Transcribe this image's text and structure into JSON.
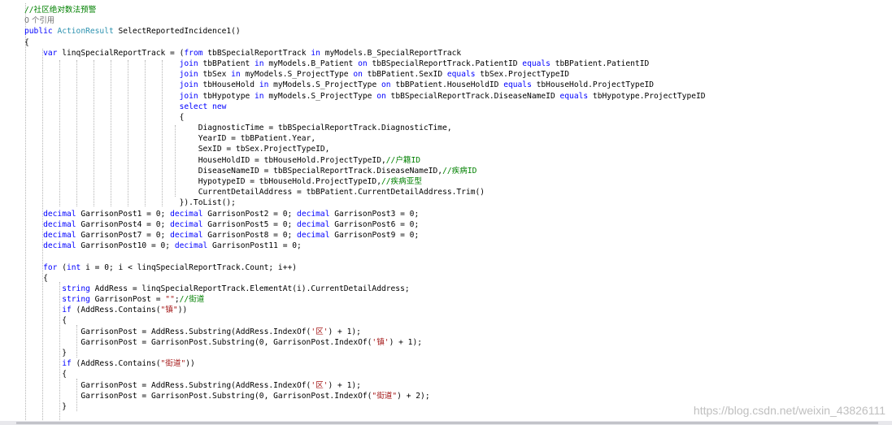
{
  "editor": {
    "code_lines": [
      {
        "indent": 0,
        "tokens": [
          {
            "t": "//社区绝对数法预警",
            "c": "com"
          }
        ]
      },
      {
        "indent": 0,
        "tokens": [
          {
            "t": "0 个引用",
            "c": "ref"
          }
        ]
      },
      {
        "indent": 0,
        "tokens": [
          {
            "t": "public ",
            "c": "kw"
          },
          {
            "t": "ActionResult",
            "c": "cls"
          },
          {
            "t": " SelectReportedIncidence1()",
            "c": "txt"
          }
        ]
      },
      {
        "indent": 0,
        "tokens": [
          {
            "t": "{",
            "c": "txt"
          }
        ]
      },
      {
        "indent": 4,
        "tokens": [
          {
            "t": "var",
            "c": "kw"
          },
          {
            "t": " linqSpecialReportTrack = (",
            "c": "txt"
          },
          {
            "t": "from",
            "c": "kw"
          },
          {
            "t": " tbBSpecialReportTrack ",
            "c": "txt"
          },
          {
            "t": "in",
            "c": "kw"
          },
          {
            "t": " myModels.B_SpecialReportTrack",
            "c": "txt"
          }
        ]
      },
      {
        "indent": 33,
        "tokens": [
          {
            "t": "join",
            "c": "kw"
          },
          {
            "t": " tbBPatient ",
            "c": "txt"
          },
          {
            "t": "in",
            "c": "kw"
          },
          {
            "t": " myModels.B_Patient ",
            "c": "txt"
          },
          {
            "t": "on",
            "c": "kw"
          },
          {
            "t": " tbBSpecialReportTrack.PatientID ",
            "c": "txt"
          },
          {
            "t": "equals",
            "c": "kw"
          },
          {
            "t": " tbBPatient.PatientID",
            "c": "txt"
          }
        ]
      },
      {
        "indent": 33,
        "tokens": [
          {
            "t": "join",
            "c": "kw"
          },
          {
            "t": " tbSex ",
            "c": "txt"
          },
          {
            "t": "in",
            "c": "kw"
          },
          {
            "t": " myModels.S_ProjectType ",
            "c": "txt"
          },
          {
            "t": "on",
            "c": "kw"
          },
          {
            "t": " tbBPatient.SexID ",
            "c": "txt"
          },
          {
            "t": "equals",
            "c": "kw"
          },
          {
            "t": " tbSex.ProjectTypeID",
            "c": "txt"
          }
        ]
      },
      {
        "indent": 33,
        "tokens": [
          {
            "t": "join",
            "c": "kw"
          },
          {
            "t": " tbHouseHold ",
            "c": "txt"
          },
          {
            "t": "in",
            "c": "kw"
          },
          {
            "t": " myModels.S_ProjectType ",
            "c": "txt"
          },
          {
            "t": "on",
            "c": "kw"
          },
          {
            "t": " tbBPatient.HouseHoldID ",
            "c": "txt"
          },
          {
            "t": "equals",
            "c": "kw"
          },
          {
            "t": " tbHouseHold.ProjectTypeID",
            "c": "txt"
          }
        ]
      },
      {
        "indent": 33,
        "tokens": [
          {
            "t": "join",
            "c": "kw"
          },
          {
            "t": " tbHypotype ",
            "c": "txt"
          },
          {
            "t": "in",
            "c": "kw"
          },
          {
            "t": " myModels.S_ProjectType ",
            "c": "txt"
          },
          {
            "t": "on",
            "c": "kw"
          },
          {
            "t": " tbBSpecialReportTrack.DiseaseNameID ",
            "c": "txt"
          },
          {
            "t": "equals",
            "c": "kw"
          },
          {
            "t": " tbHypotype.ProjectTypeID",
            "c": "txt"
          }
        ]
      },
      {
        "indent": 33,
        "tokens": [
          {
            "t": "select",
            "c": "kw"
          },
          {
            "t": " ",
            "c": "txt"
          },
          {
            "t": "new",
            "c": "kw"
          }
        ]
      },
      {
        "indent": 33,
        "tokens": [
          {
            "t": "{",
            "c": "txt"
          }
        ]
      },
      {
        "indent": 37,
        "tokens": [
          {
            "t": "DiagnosticTime = tbBSpecialReportTrack.DiagnosticTime,",
            "c": "txt"
          }
        ]
      },
      {
        "indent": 37,
        "tokens": [
          {
            "t": "YearID = tbBPatient.Year,",
            "c": "txt"
          }
        ]
      },
      {
        "indent": 37,
        "tokens": [
          {
            "t": "SexID = tbSex.ProjectTypeID,",
            "c": "txt"
          }
        ]
      },
      {
        "indent": 37,
        "tokens": [
          {
            "t": "HouseHoldID = tbHouseHold.ProjectTypeID,",
            "c": "txt"
          },
          {
            "t": "//户籍ID",
            "c": "com"
          }
        ]
      },
      {
        "indent": 37,
        "tokens": [
          {
            "t": "DiseaseNameID = tbBSpecialReportTrack.DiseaseNameID,",
            "c": "txt"
          },
          {
            "t": "//疾病ID",
            "c": "com"
          }
        ]
      },
      {
        "indent": 37,
        "tokens": [
          {
            "t": "HypotypeID = tbHouseHold.ProjectTypeID,",
            "c": "txt"
          },
          {
            "t": "//疾病亚型",
            "c": "com"
          }
        ]
      },
      {
        "indent": 37,
        "tokens": [
          {
            "t": "CurrentDetailAddress = tbBPatient.CurrentDetailAddress.Trim()",
            "c": "txt"
          }
        ]
      },
      {
        "indent": 33,
        "tokens": [
          {
            "t": "}).ToList();",
            "c": "txt"
          }
        ]
      },
      {
        "indent": 4,
        "tokens": [
          {
            "t": "decimal",
            "c": "kw"
          },
          {
            "t": " GarrisonPost1 = 0; ",
            "c": "txt"
          },
          {
            "t": "decimal",
            "c": "kw"
          },
          {
            "t": " GarrisonPost2 = 0; ",
            "c": "txt"
          },
          {
            "t": "decimal",
            "c": "kw"
          },
          {
            "t": " GarrisonPost3 = 0;",
            "c": "txt"
          }
        ]
      },
      {
        "indent": 4,
        "tokens": [
          {
            "t": "decimal",
            "c": "kw"
          },
          {
            "t": " GarrisonPost4 = 0; ",
            "c": "txt"
          },
          {
            "t": "decimal",
            "c": "kw"
          },
          {
            "t": " GarrisonPost5 = 0; ",
            "c": "txt"
          },
          {
            "t": "decimal",
            "c": "kw"
          },
          {
            "t": " GarrisonPost6 = 0;",
            "c": "txt"
          }
        ]
      },
      {
        "indent": 4,
        "tokens": [
          {
            "t": "decimal",
            "c": "kw"
          },
          {
            "t": " GarrisonPost7 = 0; ",
            "c": "txt"
          },
          {
            "t": "decimal",
            "c": "kw"
          },
          {
            "t": " GarrisonPost8 = 0; ",
            "c": "txt"
          },
          {
            "t": "decimal",
            "c": "kw"
          },
          {
            "t": " GarrisonPost9 = 0;",
            "c": "txt"
          }
        ]
      },
      {
        "indent": 4,
        "tokens": [
          {
            "t": "decimal",
            "c": "kw"
          },
          {
            "t": " GarrisonPost10 = 0; ",
            "c": "txt"
          },
          {
            "t": "decimal",
            "c": "kw"
          },
          {
            "t": " GarrisonPost11 = 0;",
            "c": "txt"
          }
        ]
      },
      {
        "indent": 0,
        "tokens": []
      },
      {
        "indent": 4,
        "tokens": [
          {
            "t": "for",
            "c": "kw"
          },
          {
            "t": " (",
            "c": "txt"
          },
          {
            "t": "int",
            "c": "kw"
          },
          {
            "t": " i = 0; i < linqSpecialReportTrack.Count; i++)",
            "c": "txt"
          }
        ]
      },
      {
        "indent": 4,
        "tokens": [
          {
            "t": "{",
            "c": "txt"
          }
        ]
      },
      {
        "indent": 8,
        "tokens": [
          {
            "t": "string",
            "c": "kw"
          },
          {
            "t": " AddRess = linqSpecialReportTrack.ElementAt(i).CurrentDetailAddress;",
            "c": "txt"
          }
        ]
      },
      {
        "indent": 8,
        "tokens": [
          {
            "t": "string",
            "c": "kw"
          },
          {
            "t": " GarrisonPost = ",
            "c": "txt"
          },
          {
            "t": "\"\"",
            "c": "str"
          },
          {
            "t": ";",
            "c": "txt"
          },
          {
            "t": "//街道",
            "c": "com"
          }
        ]
      },
      {
        "indent": 8,
        "tokens": [
          {
            "t": "if",
            "c": "kw"
          },
          {
            "t": " (AddRess.Contains(",
            "c": "txt"
          },
          {
            "t": "\"镇\"",
            "c": "str"
          },
          {
            "t": "))",
            "c": "txt"
          }
        ]
      },
      {
        "indent": 8,
        "tokens": [
          {
            "t": "{",
            "c": "txt"
          }
        ]
      },
      {
        "indent": 12,
        "tokens": [
          {
            "t": "GarrisonPost = AddRess.Substring(AddRess.IndexOf(",
            "c": "txt"
          },
          {
            "t": "'区'",
            "c": "str"
          },
          {
            "t": ") + 1);",
            "c": "txt"
          }
        ]
      },
      {
        "indent": 12,
        "tokens": [
          {
            "t": "GarrisonPost = GarrisonPost.Substring(0, GarrisonPost.IndexOf(",
            "c": "txt"
          },
          {
            "t": "'镇'",
            "c": "str"
          },
          {
            "t": ") + 1);",
            "c": "txt"
          }
        ]
      },
      {
        "indent": 8,
        "tokens": [
          {
            "t": "}",
            "c": "txt"
          }
        ]
      },
      {
        "indent": 8,
        "tokens": [
          {
            "t": "if",
            "c": "kw"
          },
          {
            "t": " (AddRess.Contains(",
            "c": "txt"
          },
          {
            "t": "\"街道\"",
            "c": "str"
          },
          {
            "t": "))",
            "c": "txt"
          }
        ]
      },
      {
        "indent": 8,
        "tokens": [
          {
            "t": "{",
            "c": "txt"
          }
        ]
      },
      {
        "indent": 12,
        "tokens": [
          {
            "t": "GarrisonPost = AddRess.Substring(AddRess.IndexOf(",
            "c": "txt"
          },
          {
            "t": "'区'",
            "c": "str"
          },
          {
            "t": ") + 1);",
            "c": "txt"
          }
        ]
      },
      {
        "indent": 12,
        "tokens": [
          {
            "t": "GarrisonPost = GarrisonPost.Substring(0, GarrisonPost.IndexOf(",
            "c": "txt"
          },
          {
            "t": "\"街道\"",
            "c": "str"
          },
          {
            "t": ") + 2);",
            "c": "txt"
          }
        ]
      },
      {
        "indent": 8,
        "tokens": [
          {
            "t": "}",
            "c": "txt"
          }
        ]
      }
    ]
  },
  "watermark": {
    "text": "https://blog.csdn.net/weixin_43826111"
  },
  "colors": {
    "keyword": "#0000ff",
    "string": "#a31515",
    "comment": "#008000",
    "type": "#2b91af",
    "reference": "#6f6f6f"
  }
}
